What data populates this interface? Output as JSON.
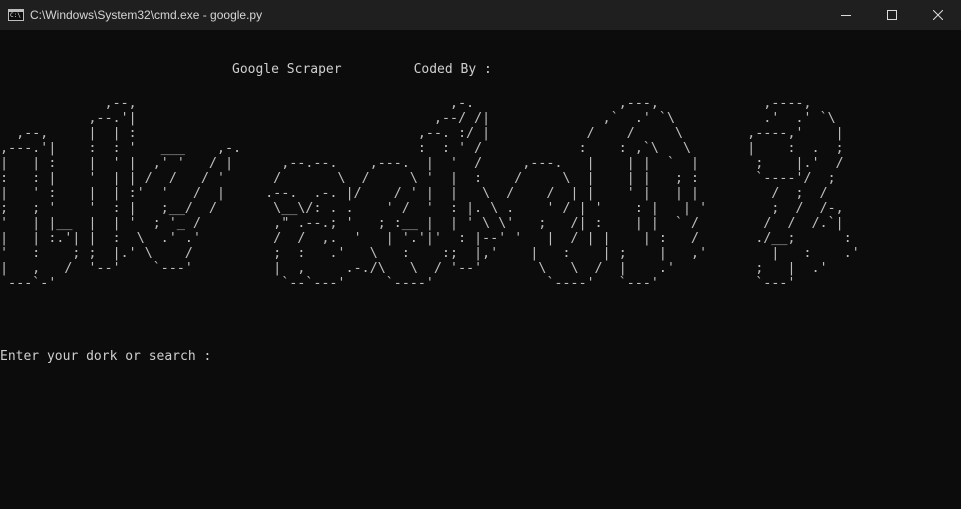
{
  "window": {
    "title": "C:\\Windows\\System32\\cmd.exe - google.py",
    "icon": "cmd-icon"
  },
  "console": {
    "header_left": "Google Scraper",
    "header_right": "Coded By :",
    "banner_art": "             ,--,                                       ,-.                  ,---,             ,----,\n           ,--.'|                                     ,--/ /|              ,`  .' `\\           .'  .' `\\\n  ,--,     |  | :                                   ,--. :/ |            /    /     \\        ,----,'    |\n,---.'|    :  : '   ___    ,-.                      :  : ' /            :    : ,`\\   \\       |    :  .  ;\n|   | :    |  ' |  ,' '   / |      ,--.--.    ,---.  |  '  /     ,---.   |    | |  `  |       ;    |.'  /\n:   : |    '  | | /  /   / '      /       \\  /     \\ '  |  :    /     \\  |    | |   ; :       `----'/  ;\n|   ' :    |  | :'  '   /  |     .--.  .-. |/    / ' |  |   \\  /    /  | |    ' |   | |         /  ;  /\n;   ; '    '  : |   ;__/  /       \\__\\/: . .    ' /  '  : |. \\ .    ' / | '    : |   | '        ;  /  /-,\n'   | |__  |  | '  ; '_ /         ,\" .--.; '   ; :__ |  | ' \\ \\'   ;   /| :    | |  ` /        /  /  /.`|\n|   | :.'| |  :  \\  .' .'         /  /  ,.  '   | '.'|'  : |--' '   |  / | |    | :   /       ./__;      :\n'   :    ; ;  |.' \\    /          ;  :   .'   \\   :    :;  |,'    |   :    | ;    |   ,'        |   :    .'\n|   ,   /  '--'    `---'          |  ,     .-./\\   \\  / '--'       \\   \\  /  |    .'          ;   |  .'\n ---`-'                            `--`---'     `----'              `----'   `---'            `---'",
    "prompt": "Enter your dork or search : "
  }
}
